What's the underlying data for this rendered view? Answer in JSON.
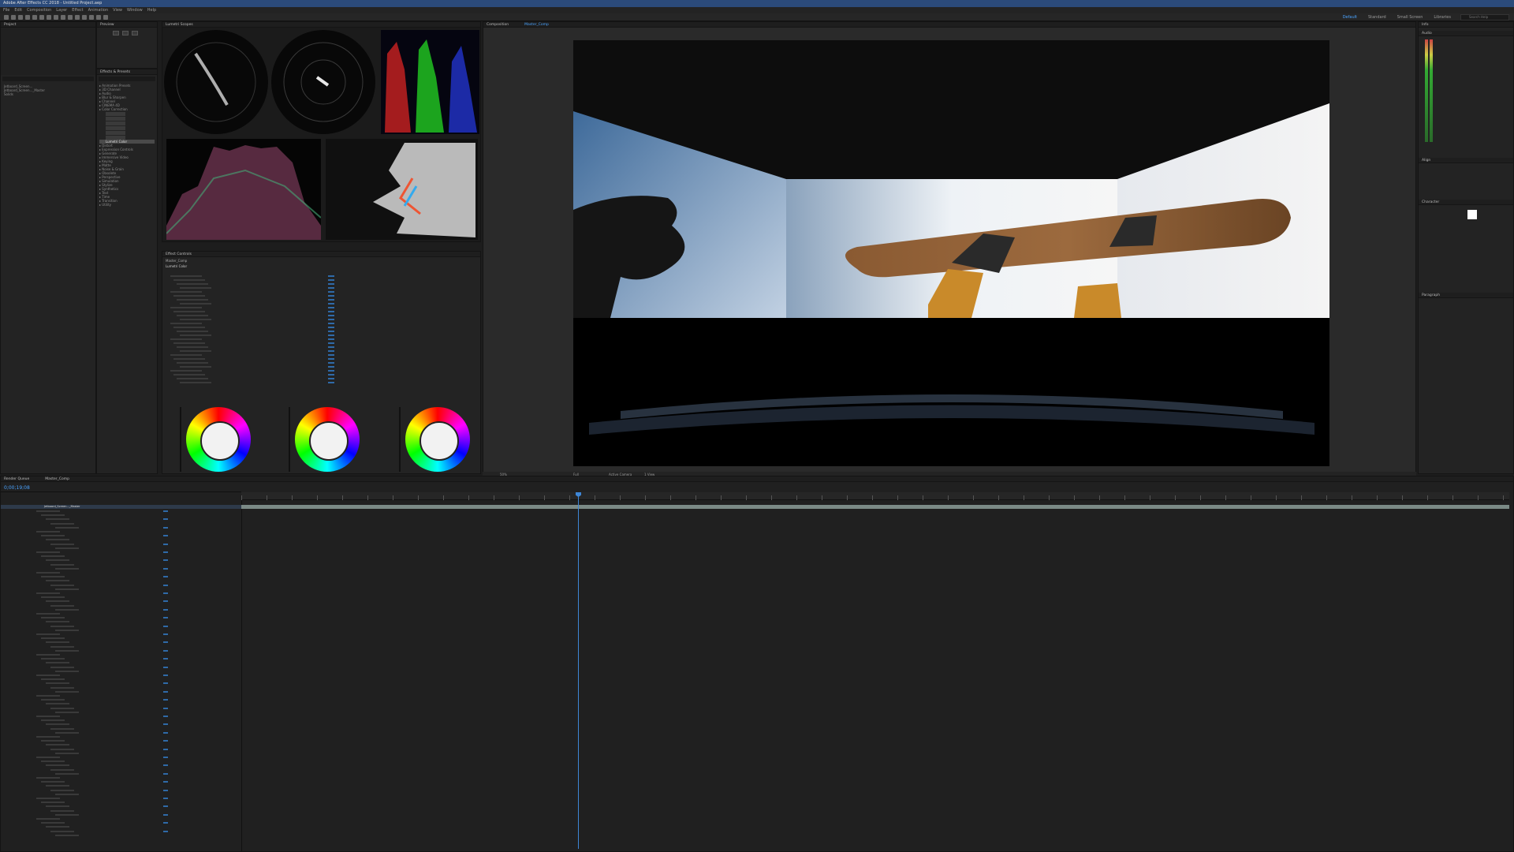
{
  "app": {
    "title": "Adobe After Effects CC 2018 - Untitled Project.aep",
    "menu": [
      "File",
      "Edit",
      "Composition",
      "Layer",
      "Effect",
      "Animation",
      "View",
      "Window",
      "Help"
    ]
  },
  "workspaces": {
    "tabs": [
      "Default",
      "Standard",
      "Small Screen",
      "Libraries"
    ],
    "active": "Default",
    "search_placeholder": "Search Help"
  },
  "project_panel": {
    "tab": "Project",
    "items": [
      "Jetboard_Screen...",
      "Jetboard_Screen..._Master",
      "Solids"
    ]
  },
  "preview_panel": {
    "tab": "Preview"
  },
  "effects_panel": {
    "tab": "Effects & Presets",
    "selected_item": "Lumetri Color",
    "categories": [
      "Animation Presets",
      "3D Channel",
      "Audio",
      "Blur & Sharpen",
      "Channel",
      "CINEMA 4D",
      "Color Correction",
      "Distort",
      "Expression Controls",
      "Generate",
      "Immersive Video",
      "Keying",
      "Matte",
      "Noise & Grain",
      "Obsolete",
      "Perspective",
      "Simulation",
      "Stylize",
      "Synthetics",
      "Text",
      "Time",
      "Transition",
      "Utility"
    ]
  },
  "lumetri_scopes": {
    "tab": "Lumetri Scopes"
  },
  "effect_controls": {
    "tab": "Effect Controls",
    "layer_label": "Master_Comp",
    "effect_name": "Lumetri Color"
  },
  "composition": {
    "tab": "Composition",
    "sub_tab": "Master_Comp",
    "zoom": "50%",
    "quality": "Full",
    "camera": "Active Camera",
    "views": "1 View"
  },
  "timeline": {
    "tab": "Master_Comp",
    "timecode": "0;00;19;08",
    "layer_name": "Jetboard_Screen..._Master",
    "render_queue_tab": "Render Queue"
  },
  "right_panels": {
    "audio": "Audio",
    "info": "Info",
    "align": "Align",
    "character": "Character",
    "paragraph": "Paragraph"
  },
  "colors": {
    "accent": "#4aa3ff",
    "titlebar": "#2b4a7a",
    "panel": "#232323",
    "layer_bar": "#7b8a86"
  }
}
